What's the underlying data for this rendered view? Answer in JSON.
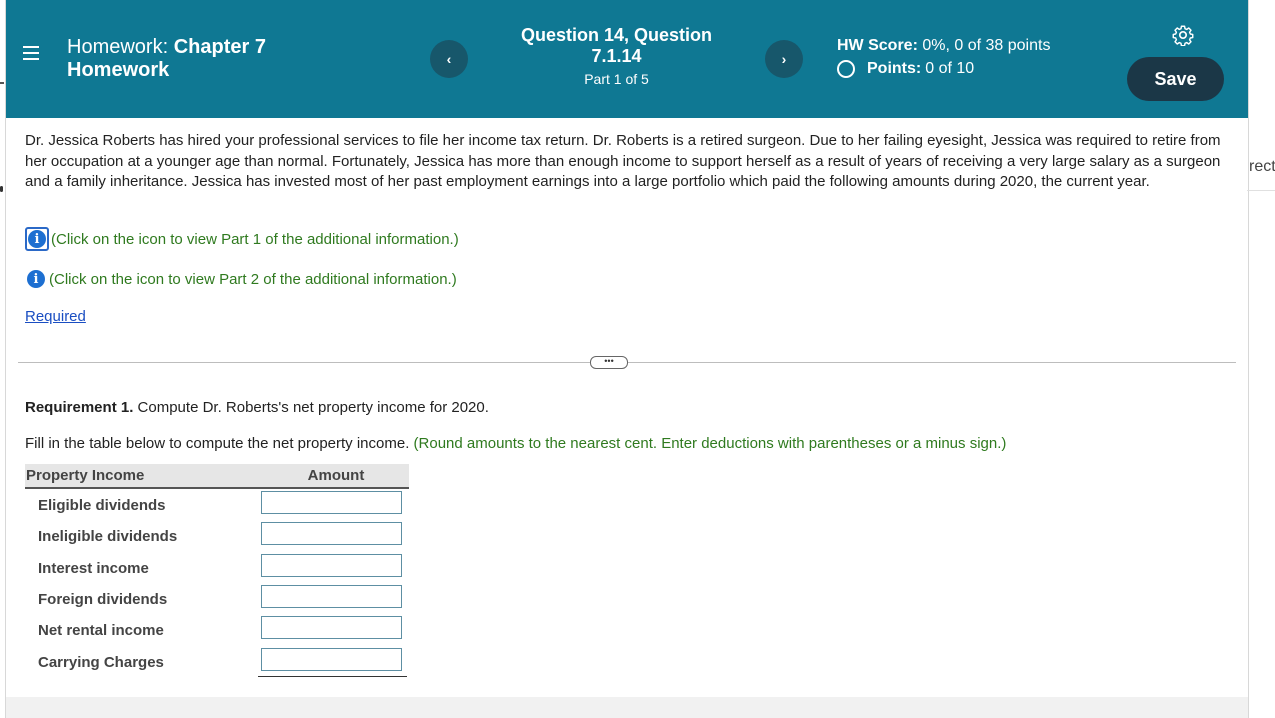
{
  "header": {
    "hw_label": "Homework:",
    "hw_title_bold": "Chapter 7",
    "hw_title_line2": "Homework",
    "prev_label": "‹",
    "next_label": "›",
    "question_title": "Question 14, Question 7.1.14",
    "question_part": "Part 1 of 5",
    "score_label": "HW Score:",
    "score_value": "0%, 0 of 38 points",
    "points_label": "Points:",
    "points_value": "0 of 10",
    "save_label": "Save",
    "accent_color": "#0f7893",
    "save_color": "#1b3747"
  },
  "problem": {
    "text": "Dr. Jessica Roberts has hired your professional services to file her income tax return. Dr. Roberts is a retired surgeon. Due to her failing eyesight, Jessica was required to retire from her occupation at a younger age than normal. Fortunately, Jessica has more than enough income to support herself as a result of years of receiving a very large salary as a surgeon and a family inheritance. Jessica has invested most of her past employment earnings into a large portfolio which paid the following amounts during 2020, the current year.",
    "info1": "(Click on the icon to view Part 1 of the additional information.)",
    "info2": "(Click on the icon to view Part 2 of the additional information.)",
    "info_icon_glyph": "i",
    "required_link": "Required"
  },
  "divider": {
    "more_label": "•••"
  },
  "requirement": {
    "bold": "Requirement 1.",
    "text": " Compute Dr. Roberts's net property income for 2020.",
    "fill_text": "Fill in the table below to compute the net property income. ",
    "fill_hint": "(Round amounts to the nearest cent. Enter deductions with parentheses or a minus sign.)"
  },
  "table": {
    "col1": "Property Income",
    "col2": "Amount",
    "rows": [
      {
        "label": "Eligible dividends",
        "value": ""
      },
      {
        "label": "Ineligible dividends",
        "value": ""
      },
      {
        "label": "Interest income",
        "value": ""
      },
      {
        "label": "Foreign dividends",
        "value": ""
      },
      {
        "label": "Net rental income",
        "value": ""
      },
      {
        "label": "Carrying Charges",
        "value": ""
      }
    ]
  },
  "side": {
    "clipped_text": "rect"
  }
}
